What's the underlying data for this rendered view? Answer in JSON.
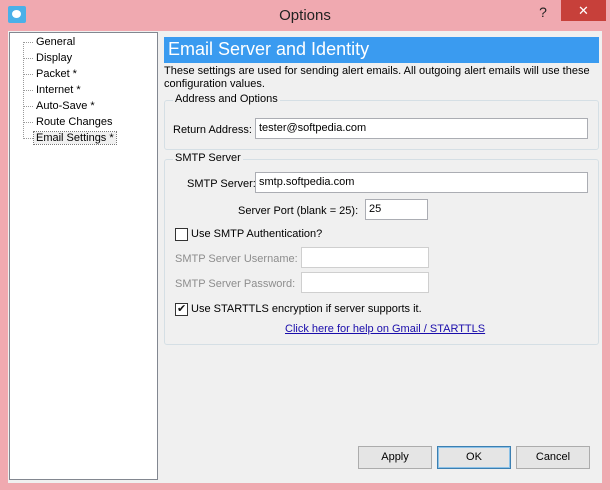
{
  "window": {
    "title": "Options",
    "help_label": "?",
    "close_label": "✕"
  },
  "tree": {
    "items": [
      {
        "label": "General"
      },
      {
        "label": "Display"
      },
      {
        "label": "Packet *"
      },
      {
        "label": "Internet *"
      },
      {
        "label": "Auto-Save *"
      },
      {
        "label": "Route Changes"
      },
      {
        "label": "Email Settings *",
        "selected": true
      }
    ]
  },
  "page": {
    "header": "Email Server and Identity",
    "description": "These settings are used for sending alert emails.  All outgoing alert emails will use these configuration values."
  },
  "address_group": {
    "title": "Address and Options",
    "return_address_label": "Return Address:",
    "return_address_value": "tester@softpedia.com"
  },
  "smtp_group": {
    "title": "SMTP Server",
    "server_label": "SMTP Server:",
    "server_value": "smtp.softpedia.com",
    "port_label": "Server Port (blank = 25):",
    "port_value": "25",
    "auth_label": "Use SMTP Authentication?",
    "auth_checked": false,
    "username_label": "SMTP Server Username:",
    "username_value": "",
    "password_label": "SMTP Server Password:",
    "password_value": "",
    "starttls_label": "Use STARTTLS encryption if server supports it.",
    "starttls_checked": true,
    "help_link": "Click here for help on Gmail / STARTTLS"
  },
  "buttons": {
    "apply": "Apply",
    "ok": "OK",
    "cancel": "Cancel"
  },
  "colors": {
    "titlebar": "#f0a9b0",
    "header_bar": "#3a9bf0",
    "close_button": "#c7403a",
    "link": "#1a0dab"
  },
  "icons": {
    "app": "app-icon",
    "help": "help-icon",
    "close": "close-icon"
  }
}
